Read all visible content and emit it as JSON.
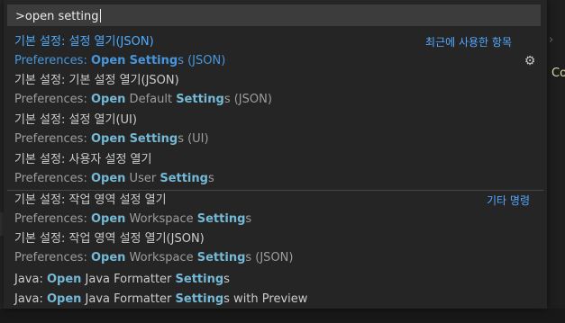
{
  "command_input": {
    "value": ">open setting"
  },
  "background": {
    "code_text": "Co",
    "chevron": "›"
  },
  "results": [
    {
      "label": "기본 설정: 설정 열기(JSON)",
      "detail_parts": [
        [
          "Preferences: ",
          false
        ],
        [
          "Open",
          true
        ],
        [
          " ",
          false
        ],
        [
          "Setting",
          true
        ],
        [
          "s (JSON)",
          false
        ]
      ],
      "tag": "최근에 사용한 항목",
      "active": true
    },
    {
      "label": "기본 설정: 기본 설정 열기(JSON)",
      "detail_parts": [
        [
          "Preferences: ",
          false
        ],
        [
          "Open",
          true
        ],
        [
          " Default ",
          false
        ],
        [
          "Setting",
          true
        ],
        [
          "s (JSON)",
          false
        ]
      ]
    },
    {
      "label": "기본 설정: 설정 열기(UI)",
      "detail_parts": [
        [
          "Preferences: ",
          false
        ],
        [
          "Open",
          true
        ],
        [
          " ",
          false
        ],
        [
          "Setting",
          true
        ],
        [
          "s (UI)",
          false
        ]
      ]
    },
    {
      "label": "기본 설정: 사용자 설정 열기",
      "detail_parts": [
        [
          "Preferences: ",
          false
        ],
        [
          "Open",
          true
        ],
        [
          " User ",
          false
        ],
        [
          "Setting",
          true
        ],
        [
          "s",
          false
        ]
      ]
    },
    {
      "label": "기본 설정: 작업 영역 설정 열기",
      "detail_parts": [
        [
          "Preferences: ",
          false
        ],
        [
          "Open",
          true
        ],
        [
          " Workspace ",
          false
        ],
        [
          "Setting",
          true
        ],
        [
          "s",
          false
        ]
      ],
      "tag": "기타 명령"
    },
    {
      "label": "기본 설정: 작업 영역 설정 열기(JSON)",
      "detail_parts": [
        [
          "Preferences: ",
          false
        ],
        [
          "Open",
          true
        ],
        [
          " Workspace ",
          false
        ],
        [
          "Setting",
          true
        ],
        [
          "s (JSON)",
          false
        ]
      ]
    },
    {
      "label_parts": [
        [
          "Java: ",
          false
        ],
        [
          "Open",
          true
        ],
        [
          " Java Formatter ",
          false
        ],
        [
          "Setting",
          true
        ],
        [
          "s",
          false
        ]
      ]
    },
    {
      "label_parts": [
        [
          "Java: ",
          false
        ],
        [
          "Open",
          true
        ],
        [
          " Java Formatter ",
          false
        ],
        [
          "Setting",
          true
        ],
        [
          "s with Preview",
          false
        ]
      ]
    }
  ],
  "icons": {
    "gear": "gear-icon",
    "chevron": "chevron-right-icon"
  },
  "colors": {
    "accent": "#4daafc",
    "highlight": "#74b9d6",
    "tag": "#55a8ff"
  }
}
